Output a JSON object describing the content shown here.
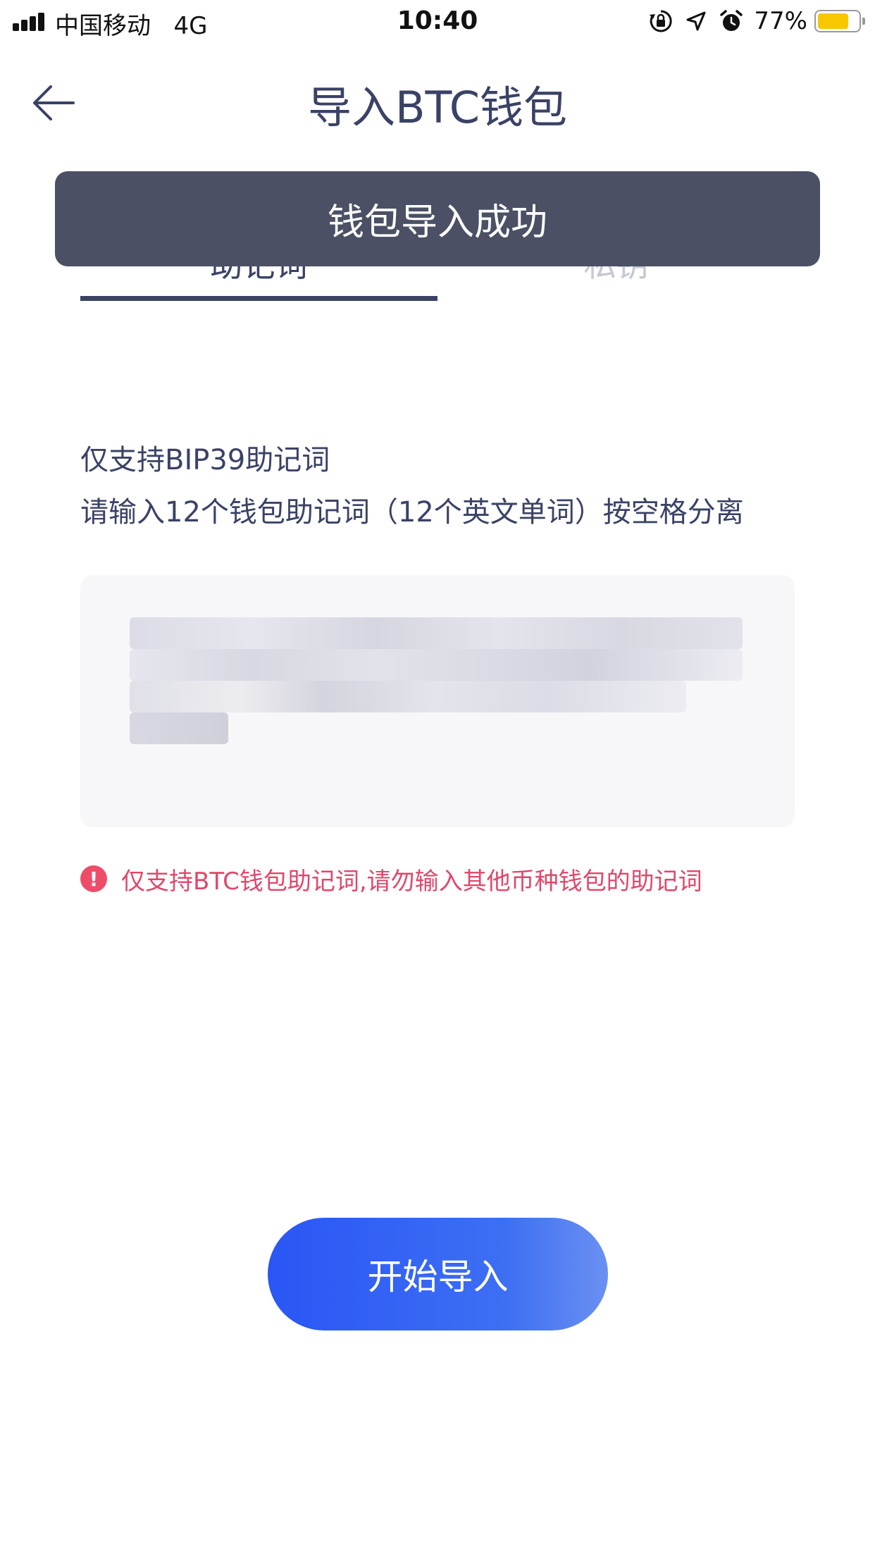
{
  "status_bar": {
    "carrier": "中国移动",
    "network": "4G",
    "time": "10:40",
    "battery_percent": "77%",
    "battery_level": 0.77,
    "battery_color": "#f7c800",
    "icons": [
      "signal-icon",
      "orientation-lock-icon",
      "location-icon",
      "alarm-icon",
      "battery-icon"
    ]
  },
  "nav": {
    "title": "导入BTC钱包",
    "back_icon": "back-arrow-icon"
  },
  "toast": {
    "message": "钱包导入成功"
  },
  "tabs": [
    {
      "label": "助记词",
      "active": true
    },
    {
      "label": "私钥",
      "active": false
    }
  ],
  "hints": {
    "line1": "仅支持BIP39助记词",
    "line2": "请输入12个钱包助记词（12个英文单词）按空格分离"
  },
  "mnemonic_input": {
    "value": "",
    "redacted": true
  },
  "warning": {
    "icon": "warning-icon",
    "text": "仅支持BTC钱包助记词,请勿输入其他币种钱包的助记词"
  },
  "actions": {
    "start_import_label": "开始导入"
  },
  "colors": {
    "primary_text": "#3a4266",
    "inactive_tab": "#c5c8d4",
    "toast_bg": "#4b5064",
    "warning": "#e0476a",
    "button_start": "#2a56f5",
    "button_end": "#6a90f2"
  }
}
